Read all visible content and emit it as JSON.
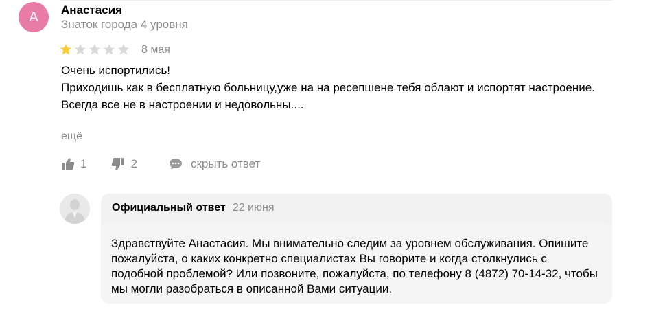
{
  "review": {
    "avatar_letter": "А",
    "avatar_color": "#e97ca7",
    "author_name": "Анастасия",
    "author_level": "Знаток города 4 уровня",
    "rating": 1,
    "rating_max": 5,
    "star_filled_color": "#fcc931",
    "star_empty_color": "#d9d9d9",
    "date": "8 мая",
    "text_lines": [
      "Очень испортились!",
      "Приходишь как в бесплатную больницу,уже на на ресепшене тебя облают и испортят настроение.",
      "Всегда все не в настроении и недовольны...."
    ],
    "more_label": "ещё",
    "likes": "1",
    "dislikes": "2",
    "hide_reply_label": "скрыть ответ",
    "icons": {
      "like": "thumbs-up-icon",
      "dislike": "thumbs-down-icon",
      "comment": "comment-icon"
    }
  },
  "reply": {
    "avatar_icon": "business-person-icon",
    "title": "Официальный ответ",
    "date": "22 июня",
    "text": "Здравствуйте Анастасия. Мы внимательно следим за уровнем обслуживания. Опишите пожалуйста, о каких конкретно специалистах Вы говорите и когда столкнулись с подобной проблемой? Или позвоните, пожалуйста, по телефону 8 (4872) 70-14-32, чтобы мы могли разобраться в описанной Вами ситуации."
  }
}
